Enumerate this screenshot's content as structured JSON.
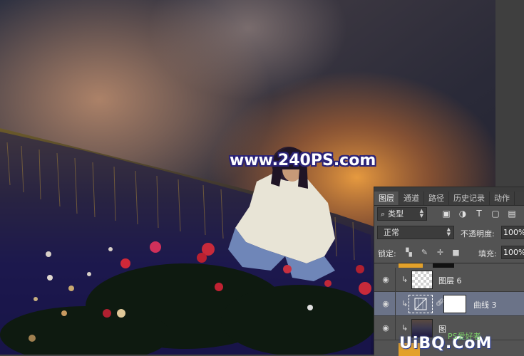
{
  "watermark": {
    "text": "www.240PS.com"
  },
  "layers_panel": {
    "tabs": [
      {
        "label": "图层",
        "active": true
      },
      {
        "label": "通道",
        "active": false
      },
      {
        "label": "路径",
        "active": false
      },
      {
        "label": "历史记录",
        "active": false
      },
      {
        "label": "动作",
        "active": false
      }
    ],
    "filter": {
      "kind_label": "类型",
      "icons": [
        "image-filter-icon",
        "adjustment-filter-icon",
        "type-filter-icon",
        "shape-filter-icon",
        "smart-object-filter-icon"
      ]
    },
    "blend_mode": "正常",
    "opacity_label": "不透明度:",
    "opacity_value": "100%",
    "lock_label": "锁定:",
    "lock_icons": [
      "lock-transparent-pixels-icon",
      "lock-image-pixels-icon",
      "lock-position-icon",
      "lock-all-icon"
    ],
    "fill_label": "填充:",
    "fill_value": "100%",
    "layers": [
      {
        "name": "图层 6",
        "visible": true,
        "clipped": true,
        "selected": false
      },
      {
        "name": "曲线 3",
        "visible": true,
        "clipped": true,
        "selected": true
      },
      {
        "name": "图",
        "visible": true,
        "clipped": true,
        "selected": false
      }
    ]
  },
  "site_mark": {
    "text": "UiBQ.CoM",
    "cn_text": "PS爱好者"
  },
  "colors": {
    "accent_selected_row": "#6b7388",
    "watermark_outline": "#2a2277",
    "panel_bg": "#535353"
  }
}
